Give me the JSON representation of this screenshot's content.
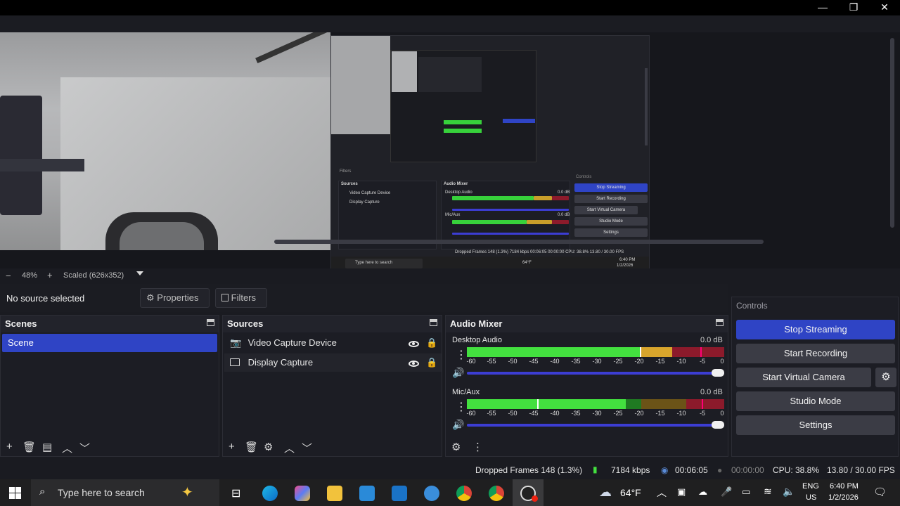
{
  "window": {
    "minimize": "—",
    "restore": "❐",
    "close": "✕"
  },
  "preview": {
    "nested": {
      "sources_title": "Sources",
      "mixer_title": "Audio Mixer",
      "controls_title": "Controls",
      "src1": "Video Capture Device",
      "src2": "Display Capture",
      "desktop": "Desktop Audio",
      "mic": "Mic/Aux",
      "db": "0.0 dB",
      "stop_streaming": "Stop Streaming",
      "start_recording": "Start Recording",
      "start_vcam": "Start Virtual Camera",
      "studio": "Studio Mode",
      "settings": "Settings",
      "search": "Type here to search",
      "status": "Dropped Frames 148 (1.3%)   7184 kbps   00:06:05   00:00:00   CPU: 38.8%   13.80 / 30.00 FPS",
      "filters": "Filters",
      "temp": "64°F",
      "time": "6:40 PM",
      "date": "1/2/2026"
    }
  },
  "zoom": {
    "minus": "−",
    "percent": "48%",
    "plus": "+",
    "scaled": "Scaled (626x352)"
  },
  "source_toolbar": {
    "no_source": "No source selected",
    "properties": "Properties",
    "filters": "Filters"
  },
  "scenes": {
    "title": "Scenes",
    "items": [
      "Scene"
    ]
  },
  "sources": {
    "title": "Sources",
    "items": [
      "Video Capture Device",
      "Display Capture"
    ]
  },
  "mixer": {
    "title": "Audio Mixer",
    "channels": [
      {
        "name": "Desktop Audio",
        "db": "0.0 dB"
      },
      {
        "name": "Mic/Aux",
        "db": "0.0 dB"
      }
    ],
    "ticks": [
      "-60",
      "-55",
      "-50",
      "-45",
      "-40",
      "-35",
      "-30",
      "-25",
      "-20",
      "-15",
      "-10",
      "-5",
      "0"
    ]
  },
  "controls": {
    "title": "Controls",
    "stop_streaming": "Stop Streaming",
    "start_recording": "Start Recording",
    "start_virtual_camera": "Start Virtual Camera",
    "studio_mode": "Studio Mode",
    "settings": "Settings",
    "accent": "#2f44c5"
  },
  "status": {
    "dropped": "Dropped Frames 148 (1.3%)",
    "kbps": "7184 kbps",
    "stream_time": "00:06:05",
    "rec_time": "00:00:00",
    "cpu": "CPU: 38.8%",
    "fps": "13.80 / 30.00 FPS"
  },
  "taskbar": {
    "search": "Type here to search",
    "temp": "64°F",
    "lang1": "ENG",
    "lang2": "US",
    "time": "6:40 PM",
    "date": "1/2/2026"
  }
}
